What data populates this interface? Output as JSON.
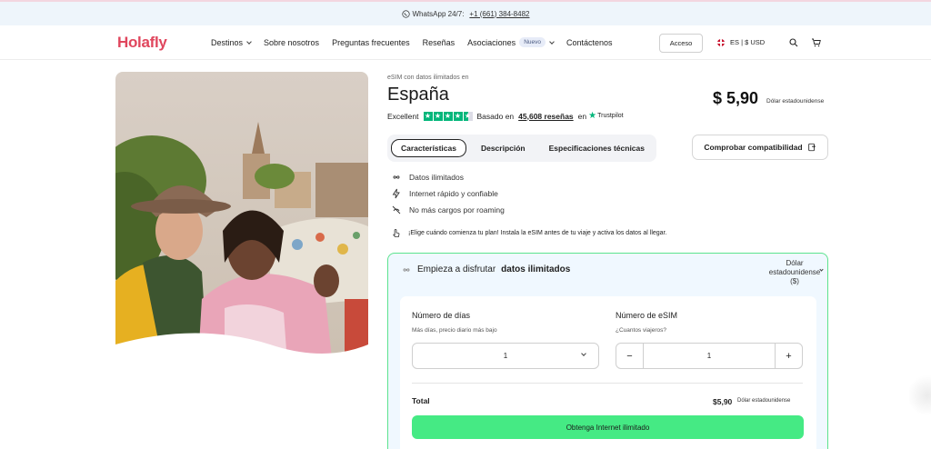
{
  "topbar": {
    "whatsapp": "WhatsApp 24/7:",
    "phone": "+1 (661) 384-8482"
  },
  "nav": {
    "logo": "Holafly",
    "items": [
      {
        "label": "Destinos"
      },
      {
        "label": "Sobre nosotros"
      },
      {
        "label": "Preguntas frecuentes"
      },
      {
        "label": "Reseñas"
      },
      {
        "label": "Asociaciones",
        "badge": "Nuevo"
      },
      {
        "label": "Contáctenos"
      }
    ],
    "access": "Acceso",
    "lang": "ES | $ USD"
  },
  "product": {
    "breadcrumb": "eSIM con datos ilimitados en",
    "title": "España",
    "rating_label": "Excellent",
    "based_on": "Basado en",
    "reviews": "45,608 reseñas",
    "on": "en",
    "trustpilot": "Trustpilot",
    "price": "$ 5,90",
    "currency": "Dólar estadounidense"
  },
  "tabs": [
    {
      "label": "Características",
      "active": true
    },
    {
      "label": "Descripción"
    },
    {
      "label": "Especificaciones técnicas"
    }
  ],
  "compat_button": "Comprobar compatibilidad",
  "features": [
    {
      "icon": "infinity-icon",
      "label": "Datos ilimitados"
    },
    {
      "icon": "lightning-icon",
      "label": "Internet rápido y confiable"
    },
    {
      "icon": "no-roaming-icon",
      "label": "No más cargos por roaming"
    }
  ],
  "note": "¡Elige cuándo comienza tu plan! Instala la eSIM antes de tu viaje y activa los datos al llegar.",
  "card": {
    "heading_prefix": "Empieza a disfrutar",
    "heading_bold": "datos ilimitados",
    "currency_select": "Dólar estadounidense ($)",
    "days_label": "Número de días",
    "days_sub": "Más días, precio diario más bajo",
    "days_value": "1",
    "esim_label": "Número de eSIM",
    "esim_sub": "¿Cuantos viajeros?",
    "esim_value": "1",
    "total_label": "Total",
    "total_price": "$5,90",
    "total_currency": "Dólar estadounidense",
    "cta": "Obtenga Internet ilimitado"
  },
  "colors": {
    "brand": "#e0465d",
    "accent": "#45ea84",
    "card_border": "#5be38e",
    "trustpilot": "#00b67a"
  }
}
